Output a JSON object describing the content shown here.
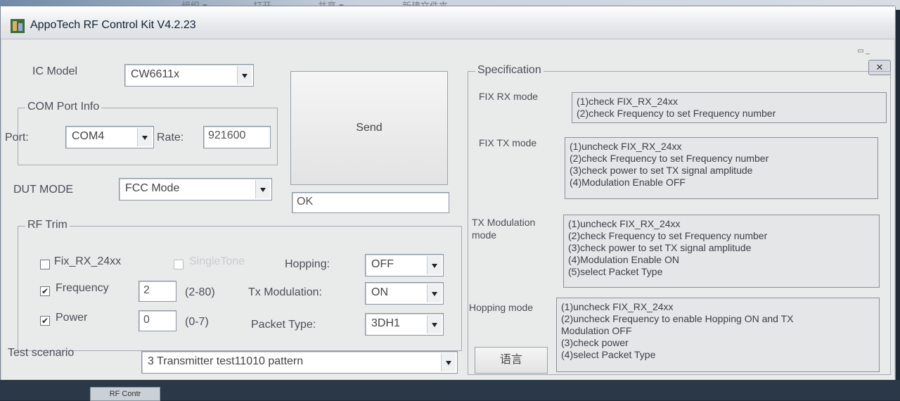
{
  "background": {
    "ghost_menu": [
      "组织 ▾",
      "打开",
      "共享 ▾",
      "新建文件夹"
    ]
  },
  "window": {
    "title": "AppoTech RF Control Kit V4.2.23",
    "close_glyph": "✕"
  },
  "left": {
    "ic_model_label": "IC Model",
    "ic_model_value": "CW6611x",
    "com_group_title": "COM Port Info",
    "port_label": "Port:",
    "port_value": "COM4",
    "rate_label": "Rate:",
    "rate_value": "921600",
    "send_label": "Send",
    "status_value": "OK",
    "dut_label": "DUT MODE",
    "dut_value": "FCC Mode",
    "rf_group_title": "RF Trim",
    "fix_rx_label": "Fix_RX_24xx",
    "fix_rx_checked": false,
    "single_tone_label": "SingleTone",
    "single_tone_checked": false,
    "hopping_label": "Hopping:",
    "hopping_value": "OFF",
    "frequency_label": "Frequency",
    "frequency_checked": true,
    "frequency_value": "2",
    "frequency_range": "(2-80)",
    "txmod_label": "Tx Modulation:",
    "txmod_value": "ON",
    "power_label": "Power",
    "power_checked": true,
    "power_value": "0",
    "power_range": "(0-7)",
    "packet_label": "Packet Type:",
    "packet_value": "3DH1",
    "scenario_label": "Test scenario",
    "scenario_value": "3 Transmitter test11010 pattern",
    "language_label": "语言",
    "check_mark": "✔"
  },
  "spec": {
    "title": "Specification",
    "modes": [
      {
        "name": "FIX RX mode",
        "lines": [
          "(1)check FIX_RX_24xx",
          "(2)check Frequency to set Frequency number"
        ]
      },
      {
        "name": "FIX TX mode",
        "lines": [
          "(1)uncheck FIX_RX_24xx",
          "(2)check Frequency to set Frequency number",
          "(3)check power to set TX signal amplitude",
          "(4)Modulation Enable OFF"
        ]
      },
      {
        "name": "TX Modulation mode",
        "lines": [
          "(1)uncheck FIX_RX_24xx",
          "(2)check Frequency to set Frequency number",
          "(3)check power to set TX signal amplitude",
          "(4)Modulation Enable ON",
          "(5)select Packet Type"
        ]
      },
      {
        "name": "Hopping mode",
        "lines": [
          "(1)uncheck FIX_RX_24xx",
          "(2)uncheck Frequency to enable Hopping ON and TX",
          "Modulation OFF",
          "(3)check power",
          "(4)select Packet Type"
        ]
      }
    ]
  },
  "taskbar": {
    "item": "RF Contr"
  },
  "colors": {
    "window_bg": "#e9eaea",
    "accent": "#123"
  }
}
